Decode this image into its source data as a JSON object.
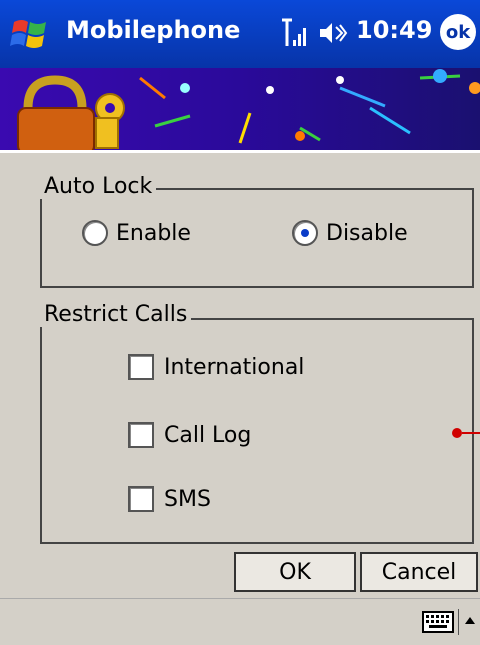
{
  "titlebar": {
    "app_title": "Mobilephone",
    "time": "10:49",
    "ok_label": "ok",
    "icons": [
      "windows-start-icon",
      "signal-icon",
      "volume-icon",
      "ok-icon"
    ]
  },
  "auto_lock": {
    "legend": "Auto Lock",
    "options": [
      {
        "label": "Enable",
        "selected": false
      },
      {
        "label": "Disable",
        "selected": true
      }
    ]
  },
  "restrict_calls": {
    "legend": "Restrict Calls",
    "options": [
      {
        "label": "International",
        "checked": false
      },
      {
        "label": "Call Log",
        "checked": false
      },
      {
        "label": "SMS",
        "checked": false
      }
    ]
  },
  "buttons": {
    "ok": "OK",
    "cancel": "Cancel"
  },
  "colors": {
    "titlebar": "#0734a8",
    "background": "#d4d0c8",
    "radio_selected": "#0a3cc8",
    "annotation": "#d00000"
  }
}
